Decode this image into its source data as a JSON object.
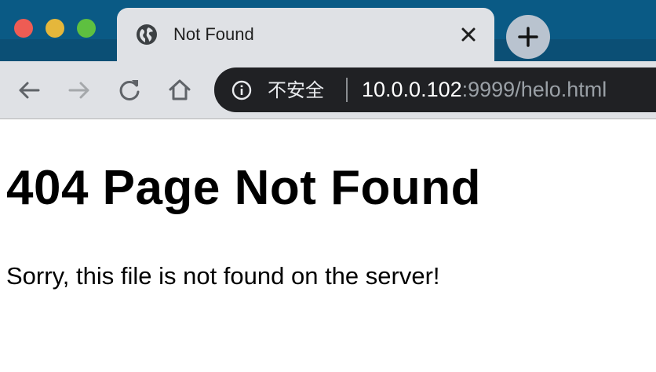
{
  "browser": {
    "tab": {
      "title": "Not Found",
      "icon": "globe-icon",
      "close_icon": "close-icon"
    },
    "new_tab_icon": "plus-icon",
    "nav": {
      "back_icon": "arrow-left-icon",
      "forward_icon": "arrow-right-icon",
      "reload_icon": "reload-icon",
      "home_icon": "home-icon"
    },
    "omnibox": {
      "security_icon": "info-icon",
      "security_label": "不安全",
      "url_host": "10.0.0.102",
      "url_rest": ":9999/helo.html"
    },
    "traffic_lights": {
      "close": "#ee5c54",
      "minimize": "#e5b73b",
      "maximize": "#5ec040"
    },
    "colors": {
      "frame": "#0a5a85",
      "toolbar": "#dfe1e5",
      "omnibox": "#202124"
    }
  },
  "page": {
    "heading": "404 Page Not Found",
    "message": "Sorry, this file is not found on the server!"
  }
}
